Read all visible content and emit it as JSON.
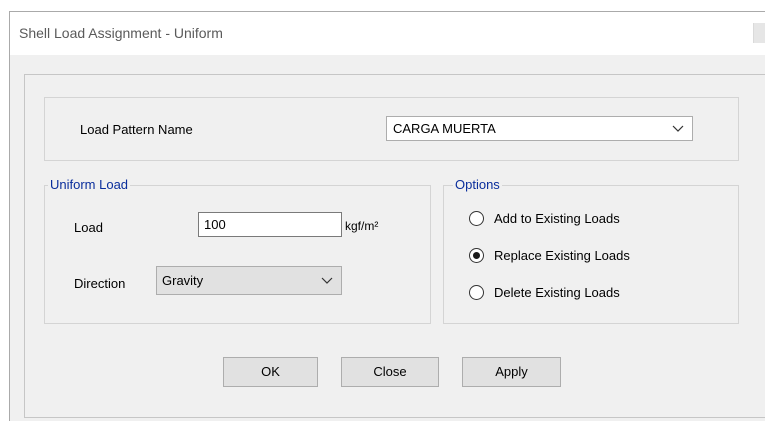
{
  "window": {
    "title": "Shell Load Assignment - Uniform"
  },
  "load_pattern": {
    "label": "Load Pattern Name",
    "selected": "CARGA MUERTA"
  },
  "uniform_load": {
    "legend": "Uniform Load",
    "load_label": "Load",
    "load_value": "100",
    "unit": "kgf/m²",
    "direction_label": "Direction",
    "direction_selected": "Gravity"
  },
  "options": {
    "legend": "Options",
    "items": [
      {
        "label": "Add to Existing Loads",
        "selected": false
      },
      {
        "label": "Replace Existing Loads",
        "selected": true
      },
      {
        "label": "Delete Existing Loads",
        "selected": false
      }
    ]
  },
  "buttons": {
    "ok": "OK",
    "close": "Close",
    "apply": "Apply"
  },
  "icons": {
    "dropdown": "chevron-down-icon",
    "window_close": "close-icon"
  }
}
